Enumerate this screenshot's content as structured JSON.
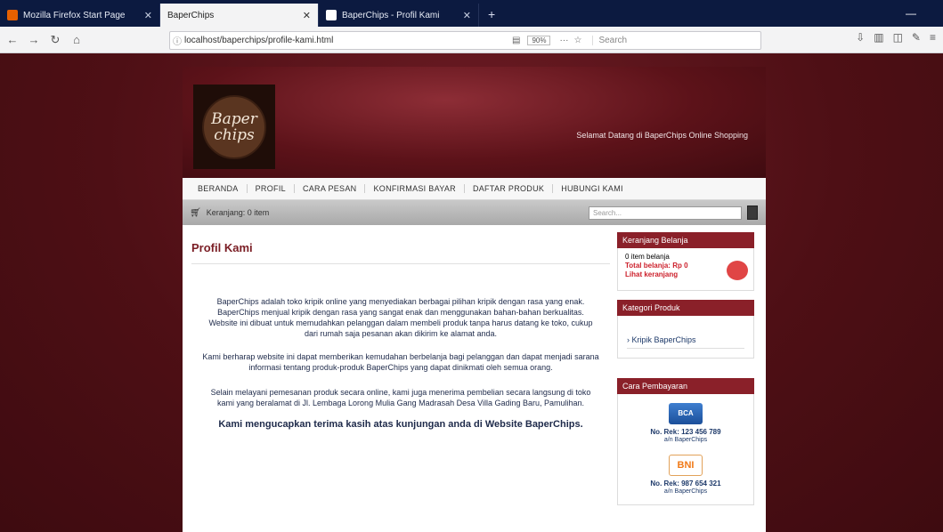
{
  "browser": {
    "tabs": [
      {
        "title": "Mozilla Firefox Start Page",
        "active": false
      },
      {
        "title": "BaperChips",
        "active": true
      },
      {
        "title": "BaperChips - Profil Kami",
        "active": false
      }
    ],
    "new_tab": "+",
    "url": "localhost/baperchips/profile-kami.html",
    "zoom": "90%",
    "more": "···",
    "search_placeholder": "Search"
  },
  "site": {
    "logo_line1": "Baper",
    "logo_line2": "chips",
    "tagline": "Selamat Datang di BaperChips Online Shopping",
    "menu": [
      "BERANDA",
      "PROFIL",
      "CARA PESAN",
      "KONFIRMASI BAYAR",
      "DAFTAR PRODUK",
      "HUBUNGI KAMI"
    ],
    "cart_text": "Keranjang: 0 item",
    "search_placeholder": "Search..."
  },
  "main": {
    "title": "Profil Kami",
    "para1": "BaperChips adalah toko kripik online yang menyediakan berbagai pilihan kripik dengan rasa yang enak. BaperChips menjual kripik dengan rasa yang sangat enak dan menggunakan bahan-bahan berkualitas. Website ini dibuat untuk memudahkan pelanggan dalam membeli produk tanpa harus datang ke toko, cukup dari rumah saja pesanan akan dikirim ke alamat anda.",
    "para2": "Kami berharap website ini dapat memberikan kemudahan berbelanja bagi pelanggan dan dapat menjadi sarana informasi tentang produk-produk BaperChips yang dapat dinikmati oleh semua orang.",
    "para3": "Selain melayani pemesanan produk secara online, kami juga menerima pembelian secara langsung di toko kami yang beralamat di Jl. Lembaga Lorong Mulia Gang Madrasah Desa Villa Gading Baru, Pamulihan.",
    "closing": "Kami mengucapkan terima kasih atas kunjungan anda di Website BaperChips."
  },
  "sidebar": {
    "belanja_title": "Keranjang Belanja",
    "belanja_line1": "0 item belanja",
    "belanja_line2": "Total belanja: Rp 0",
    "belanja_line3": "Lihat keranjang",
    "kategori_title": "Kategori Produk",
    "kategori_item": "› Kripik BaperChips",
    "bayar_title": "Cara Pembayaran",
    "bca_label": "BCA",
    "bca_rek": "No. Rek: 123 456 789",
    "bca_an": "a/n BaperChips",
    "bni_label": "BNI",
    "bni_rek": "No. Rek: 987 654 321",
    "bni_an": "a/n BaperChips"
  },
  "colors": {
    "page_bg": "#4e0f15",
    "accent": "#8a2029",
    "title": "#7a1d24",
    "text": "#1e2a4a"
  }
}
